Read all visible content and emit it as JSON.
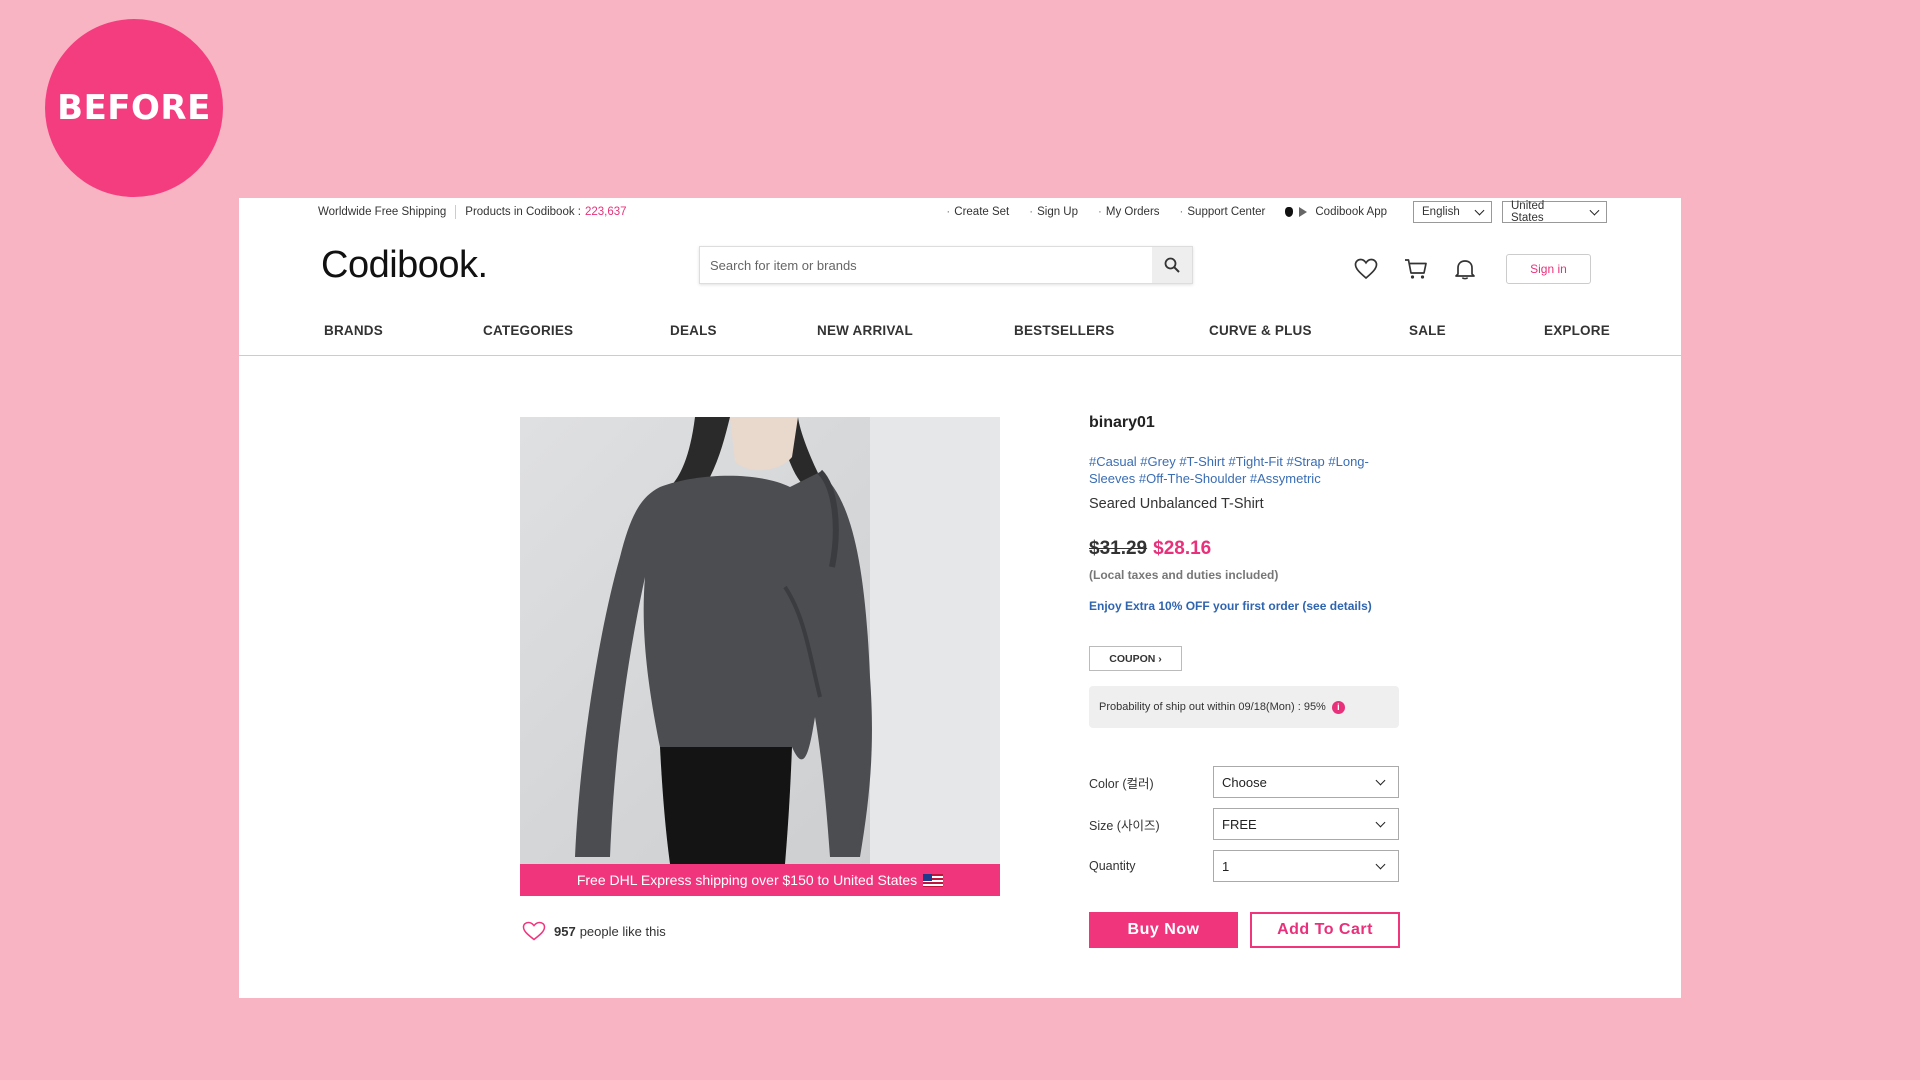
{
  "badge": "BEFORE",
  "topbar": {
    "shipping": "Worldwide Free Shipping",
    "products_label": "Products in Codibook :",
    "products_count": "223,637",
    "links": [
      "Create Set",
      "Sign Up",
      "My Orders",
      "Support Center"
    ],
    "app_label": "Codibook App",
    "language": "English",
    "country": "United States"
  },
  "header": {
    "logo": "Codibook.",
    "search_placeholder": "Search for item or brands",
    "signin": "Sign in"
  },
  "nav": [
    "BRANDS",
    "CATEGORIES",
    "DEALS",
    "NEW ARRIVAL",
    "BESTSELLERS",
    "CURVE & PLUS",
    "SALE",
    "EXPLORE"
  ],
  "product": {
    "image_banner": "Free DHL Express shipping over $150 to United States",
    "likes_count": "957",
    "likes_text": "people like this",
    "brand": "binary01",
    "tags": "#Casual #Grey #T-Shirt #Tight-Fit #Strap #Long-Sleeves #Off-The-Shoulder #Assymetric",
    "name": "Seared Unbalanced T-Shirt",
    "old_price": "$31.29",
    "price": "$28.16",
    "taxes": "(Local taxes and duties included)",
    "promo": "Enjoy Extra 10% OFF your first order (see details)",
    "coupon": "COUPON ›",
    "ship_probability": "Probability of ship out within 09/18(Mon) : 95%",
    "options": [
      {
        "label": "Color (컬러)",
        "value": "Choose"
      },
      {
        "label": "Size (사이즈)",
        "value": "FREE"
      },
      {
        "label": "Quantity",
        "value": "1"
      }
    ],
    "buy_now": "Buy Now",
    "add_to_cart": "Add To Cart"
  },
  "colors": {
    "accent": "#f0357d",
    "background": "#f8b4c3",
    "link": "#3a6db3"
  }
}
